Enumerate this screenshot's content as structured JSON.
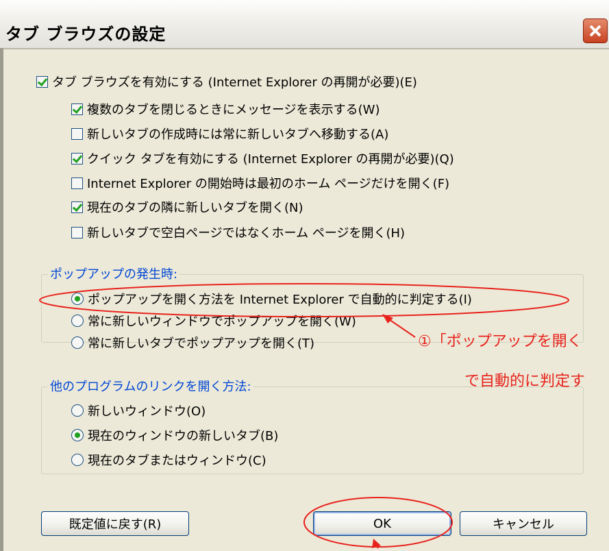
{
  "dialog": {
    "title": "タブ ブラウズの設定",
    "close_icon": "close-icon"
  },
  "main_option": {
    "label": "タブ ブラウズを有効にする (Internet Explorer の再開が必要)(E)",
    "checked": true
  },
  "sub_options": [
    {
      "label": "複数のタブを閉じるときにメッセージを表示する(W)",
      "checked": true
    },
    {
      "label": "新しいタブの作成時には常に新しいタブへ移動する(A)",
      "checked": false
    },
    {
      "label": "クイック タブを有効にする (Internet Explorer の再開が必要)(Q)",
      "checked": true
    },
    {
      "label": "Internet Explorer の開始時は最初のホーム ページだけを開く(F)",
      "checked": false
    },
    {
      "label": "現在のタブの隣に新しいタブを開く(N)",
      "checked": true
    },
    {
      "label": "新しいタブで空白ページではなくホーム ページを開く(H)",
      "checked": false
    }
  ],
  "popup_group": {
    "legend": "ポップアップの発生時:",
    "options": [
      {
        "label": "ポップアップを開く方法を Internet Explorer で自動的に判定する(I)",
        "selected": true
      },
      {
        "label": "常に新しいウィンドウでポップアップを開く(W)",
        "selected": false
      },
      {
        "label": "常に新しいタブでポップアップを開く(T)",
        "selected": false
      }
    ]
  },
  "links_group": {
    "legend": "他のプログラムのリンクを開く方法:",
    "options": [
      {
        "label": "新しいウィンドウ(O)",
        "selected": false
      },
      {
        "label": "現在のウィンドウの新しいタブ(B)",
        "selected": true
      },
      {
        "label": "現在のタブまたはウィンドウ(C)",
        "selected": false
      }
    ]
  },
  "buttons": {
    "restore_defaults": "既定値に戻す(R)",
    "ok": "OK",
    "cancel": "キャンセル"
  },
  "annotation": {
    "line1": "①「ポップアップを開く",
    "line2": "で自動的に判定す",
    "color": "#e8221c"
  },
  "colors": {
    "accent": "#0046d5",
    "check": "#21a121",
    "annotation": "#e8221c"
  }
}
